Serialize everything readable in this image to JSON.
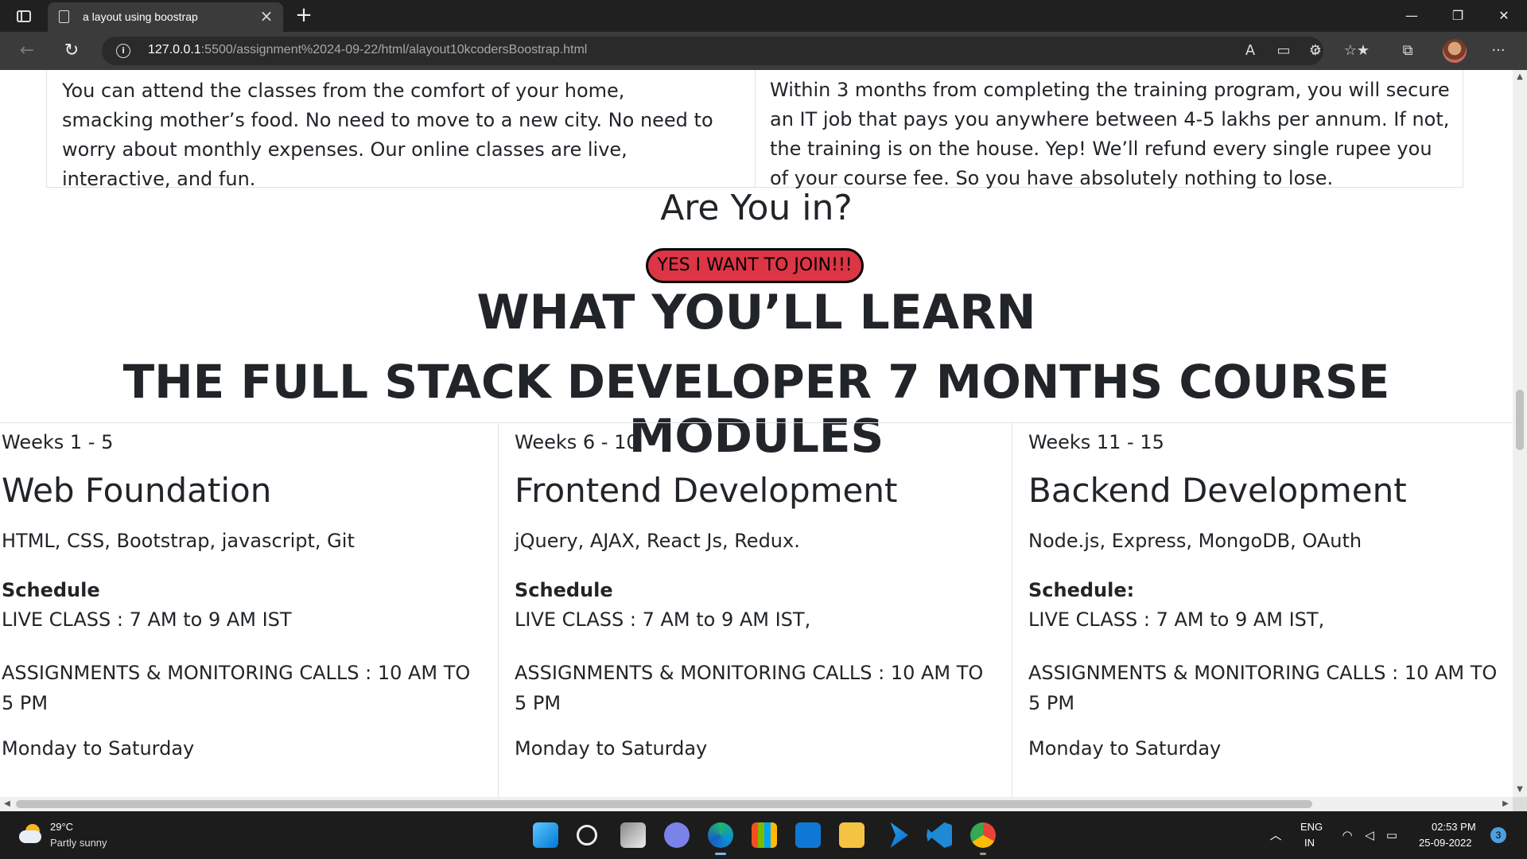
{
  "browser": {
    "tab_title": "a layout using boostrap",
    "url_host": "127.0.0.1",
    "url_rest": ":5500/assignment%2024-09-22/html/alayout10kcodersBoostrap.html"
  },
  "page": {
    "feature_left": "You can attend the classes from the comfort of your home, smacking mother’s food. No need to move to a new city. No need to worry about monthly expenses. Our online classes are live, interactive, and fun.",
    "feature_right": "Within 3 months from completing the training program, you will secure an IT job that pays you anywhere between 4-5 lakhs per annum. If not, the training is on the house. Yep! We’ll refund every single rupee you of your course fee. So you have absolutely nothing to lose.",
    "are_you_in": "Are You in?",
    "join_button": "YES I WANT TO JOIN!!!",
    "learn_title": "WHAT YOU’LL LEARN",
    "course_title": "THE FULL STACK DEVELOPER 7 MONTHS COURSE MODULES",
    "modules": [
      {
        "weeks": "Weeks 1 - 5",
        "title": "Web Foundation",
        "tech": "HTML, CSS, Bootstrap, javascript, Git",
        "schedule": "Schedule",
        "live": "LIVE CLASS : 7 AM to 9 AM IST",
        "assignments": "ASSIGNMENTS & MONITORING CALLS : 10 AM TO 5 PM",
        "days": "Monday to Saturday"
      },
      {
        "weeks": "Weeks 6 - 10",
        "title": "Frontend Development",
        "tech": "jQuery, AJAX, React Js, Redux.",
        "schedule": "Schedule",
        "live": "LIVE CLASS : 7 AM to 9 AM IST,",
        "assignments": "ASSIGNMENTS & MONITORING CALLS : 10 AM TO 5 PM",
        "days": "Monday to Saturday"
      },
      {
        "weeks": "Weeks 11 - 15",
        "title": "Backend Development",
        "tech": "Node.js, Express, MongoDB, OAuth",
        "schedule": "Schedule:",
        "live": "LIVE CLASS : 7 AM to 9 AM IST,",
        "assignments": "ASSIGNMENTS & MONITORING CALLS : 10 AM TO 5 PM",
        "days": "Monday to Saturday"
      }
    ]
  },
  "taskbar": {
    "temperature": "29°C",
    "weather": "Partly sunny",
    "lang_top": "ENG",
    "lang_bottom": "IN",
    "time": "02:53 PM",
    "date": "25-09-2022",
    "notifications": "3",
    "apps": [
      "start-icon",
      "search-icon",
      "task-view-icon",
      "chat-icon",
      "edge-icon",
      "store-icon",
      "mail-icon",
      "file-explorer-icon",
      "power-automate-icon",
      "vscode-icon",
      "chrome-icon"
    ]
  },
  "colors": {
    "join_button_bg": "#dc3545",
    "page_text": "#212529",
    "chrome_bg": "#202020",
    "toolbar_bg": "#3b3b3b"
  }
}
